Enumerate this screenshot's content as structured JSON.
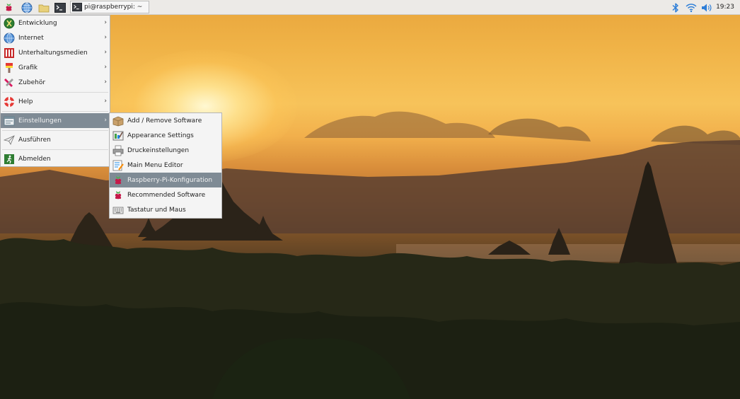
{
  "taskbar": {
    "launchers": [
      {
        "name": "raspberry-menu",
        "icon": "raspberry-icon"
      },
      {
        "name": "web-browser",
        "icon": "globe-icon"
      },
      {
        "name": "file-manager",
        "icon": "folder-icon"
      },
      {
        "name": "terminal",
        "icon": "terminal-icon"
      }
    ],
    "active_window_title": "pi@raspberrypi: ~",
    "tray_icons": [
      "bluetooth-icon",
      "wifi-icon",
      "volume-icon"
    ],
    "clock": "19:23"
  },
  "main_menu": {
    "items": [
      {
        "label": "Entwicklung",
        "icon": "development-icon",
        "submenu": true
      },
      {
        "label": "Internet",
        "icon": "globe-icon",
        "submenu": true
      },
      {
        "label": "Unterhaltungsmedien",
        "icon": "multimedia-icon",
        "submenu": true
      },
      {
        "label": "Grafik",
        "icon": "graphics-icon",
        "submenu": true
      },
      {
        "label": "Zubehör",
        "icon": "accessories-icon",
        "submenu": true
      },
      {
        "label": "Help",
        "icon": "lifebuoy-icon",
        "submenu": true
      },
      {
        "label": "Einstellungen",
        "icon": "preferences-icon",
        "submenu": true,
        "selected": true
      },
      {
        "label": "Ausführen",
        "icon": "paper-plane-icon",
        "submenu": false
      },
      {
        "label": "Abmelden",
        "icon": "exit-icon",
        "submenu": false
      }
    ],
    "arrow": "›"
  },
  "settings_submenu": {
    "items": [
      {
        "label": "Add / Remove Software",
        "icon": "package-icon"
      },
      {
        "label": "Appearance Settings",
        "icon": "appearance-icon"
      },
      {
        "label": "Druckeinstellungen",
        "icon": "printer-icon"
      },
      {
        "label": "Main Menu Editor",
        "icon": "menu-editor-icon"
      },
      {
        "label": "Raspberry-Pi-Konfiguration",
        "icon": "raspberry-icon",
        "selected": true
      },
      {
        "label": "Recommended Software",
        "icon": "raspberry-icon"
      },
      {
        "label": "Tastatur und Maus",
        "icon": "keyboard-icon"
      }
    ]
  },
  "colors": {
    "taskbar_bg": "#eceae7",
    "menu_bg": "#f4f4f4",
    "selection": "#7f8b95",
    "raspberry_red": "#c51a4a"
  }
}
